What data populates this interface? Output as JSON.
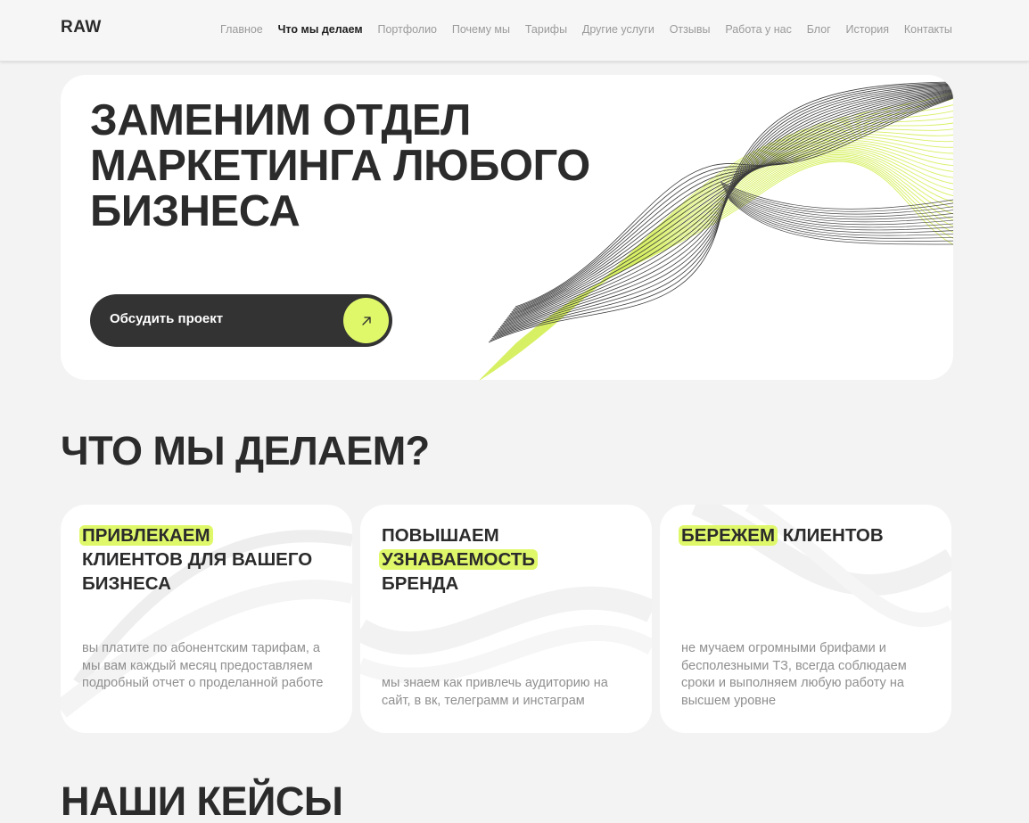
{
  "header": {
    "logo": "RAW",
    "nav": [
      {
        "label": "Главное"
      },
      {
        "label": "Что мы делаем",
        "active": true
      },
      {
        "label": "Портфолио"
      },
      {
        "label": "Почему мы"
      },
      {
        "label": "Тарифы"
      },
      {
        "label": "Другие услуги"
      },
      {
        "label": "Отзывы"
      },
      {
        "label": "Работа у нас"
      },
      {
        "label": "Блог"
      },
      {
        "label": "История"
      },
      {
        "label": "Контакты"
      }
    ]
  },
  "hero": {
    "title_lines": [
      "ЗАМЕНИМ ОТДЕЛ",
      "МАРКЕТИНГА ЛЮБОГО",
      "БИЗНЕСА"
    ],
    "cta_label": "Обсудить проект",
    "cta_icon": "arrow-up-right-icon"
  },
  "services": {
    "title": "ЧТО МЫ ДЕЛАЕМ?",
    "cards": [
      {
        "highlight": "ПРИВЛЕКАЕМ",
        "rest": "КЛИЕНТОВ ДЛЯ ВАШЕГО БИЗНЕСА",
        "description": "вы платите по абонентским тарифам, а мы вам каждый месяц предоставляем подробный отчет о проделанной работе"
      },
      {
        "before": "ПОВЫШАЕМ",
        "highlight": "УЗНАВАЕМОСТЬ",
        "after": "БРЕНДА",
        "description": "мы знаем как привлечь аудиторию на сайт, в вк, телеграмм и инстаграм"
      },
      {
        "highlight": "БЕРЕЖЕМ",
        "rest": "КЛИЕНТОВ",
        "description": "не мучаем огромными брифами и бесполезными ТЗ, всегда соблюдаем сроки и выполняем любую работу на высшем уровне"
      }
    ]
  },
  "cases": {
    "title": "НАШИ КЕЙСЫ"
  },
  "colors": {
    "accent": "#dff86a",
    "dark": "#333333",
    "background": "#f3f3f3"
  }
}
